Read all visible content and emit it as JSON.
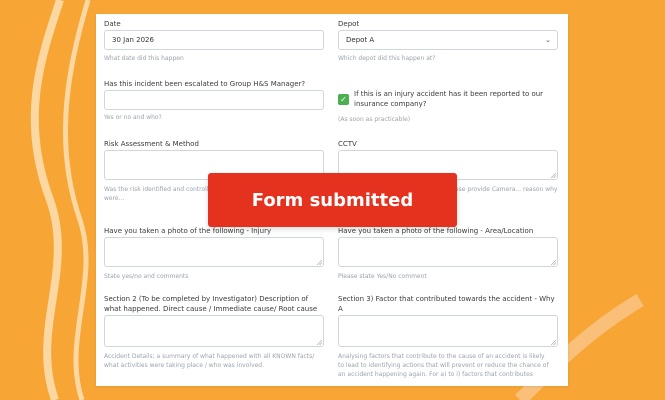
{
  "form": {
    "date": {
      "label": "Date",
      "value": "30 Jan 2026",
      "help": "What date did this happen"
    },
    "depot": {
      "label": "Depot",
      "value": "Depot A",
      "help": "Which depot did this happen at?"
    },
    "escalated": {
      "label": "Has this incident been escalated to Group H&S Manager?",
      "value": "",
      "help": "Yes or no and who?"
    },
    "insurance": {
      "label": "If this is an injury accident has it been reported to our insurance company?",
      "checked": true,
      "help": "(As soon as practicable)"
    },
    "risk": {
      "label": "Risk Assessment & Method",
      "value": "",
      "help": "Was the risk identified and controlled... and evaluate if the procedures were..."
    },
    "cctv": {
      "label": "CCTV",
      "value": "",
      "help": "...depot or vehicle to determine if... Please provide Camera... reason why"
    },
    "photo_injury": {
      "label": "Have you taken a photo of the following - Injury",
      "value": "",
      "help": "State yes/no and comments"
    },
    "photo_area": {
      "label": "Have you taken a photo of the following - Area/Location",
      "value": "",
      "help": "Please state Yes/No comment"
    },
    "section2": {
      "label_line1": "Section 2 (To be completed by Investigator) Description of",
      "label_line2": "what happened. Direct cause / Immediate cause/ Root cause",
      "value": "",
      "help_line1": "Accident Details; a summary of what happened with all KNOWN facts/",
      "help_line2": "what activities were taking place / who was involved."
    },
    "section3": {
      "label_line1": "Section 3) Factor that contributed towards the accident - Why",
      "label_line2": "A",
      "value": "",
      "help_line1": "Analysing factors that contribute to the cause of an accident is likely",
      "help_line2": "to lead to identifying actions that will prevent or reduce the chance of",
      "help_line3": "an accident happening again. For a) to i) factors that contributes"
    }
  },
  "toast": {
    "message": "Form submitted"
  },
  "colors": {
    "background": "#f7a636",
    "toast": "#e4321e",
    "checkbox": "#4caf50"
  }
}
